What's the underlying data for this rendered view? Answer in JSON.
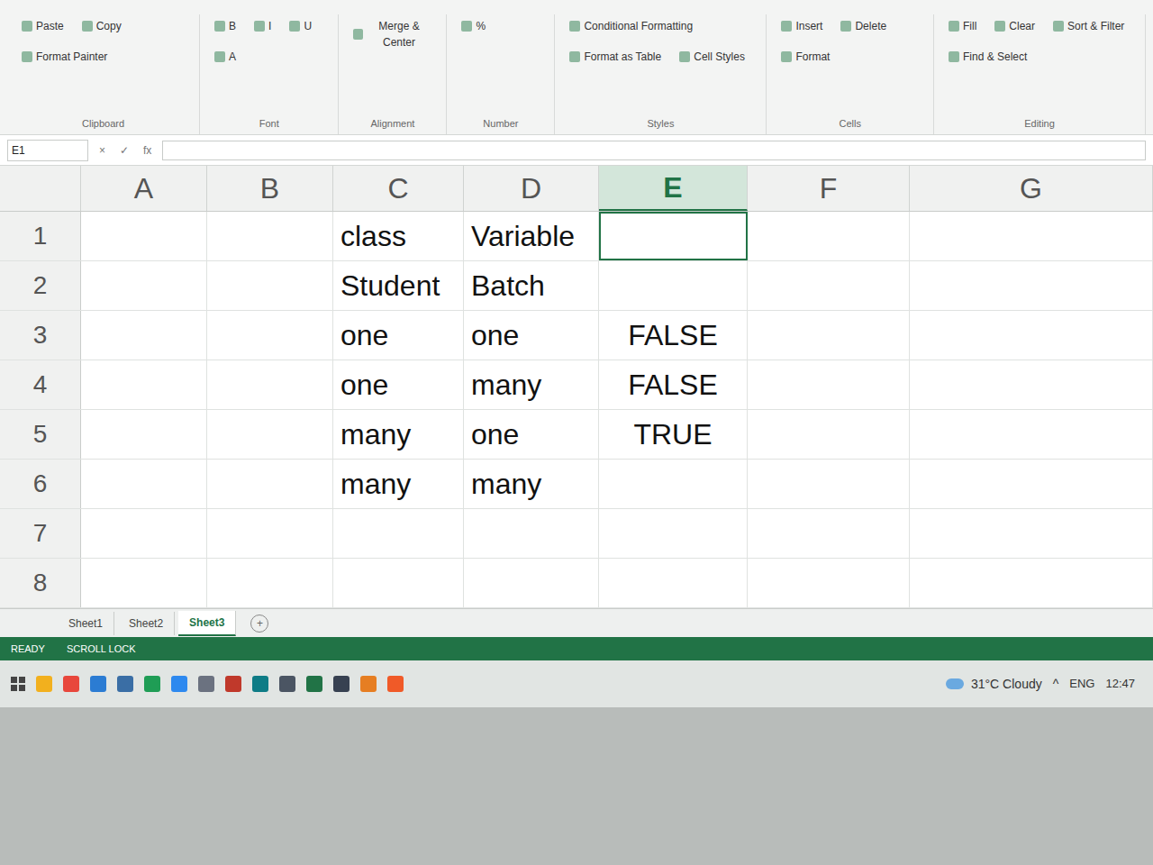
{
  "ribbon": {
    "groups": [
      {
        "label": "Clipboard",
        "items": [
          "Paste",
          "Copy",
          "Format Painter"
        ]
      },
      {
        "label": "Font",
        "items": [
          "B",
          "I",
          "U",
          "A"
        ]
      },
      {
        "label": "Alignment",
        "items": [
          "Merge & Center"
        ]
      },
      {
        "label": "Number",
        "items": [
          "%"
        ]
      },
      {
        "label": "Styles",
        "items": [
          "Conditional Formatting",
          "Format as Table",
          "Cell Styles"
        ]
      },
      {
        "label": "Cells",
        "items": [
          "Insert",
          "Delete",
          "Format"
        ]
      },
      {
        "label": "Editing",
        "items": [
          "Fill",
          "Clear",
          "Sort & Filter",
          "Find & Select"
        ]
      }
    ]
  },
  "name_box": "E1",
  "formula_buttons": [
    "×",
    "✓",
    "fx"
  ],
  "columns": [
    {
      "label": "A",
      "selected": false
    },
    {
      "label": "B",
      "selected": false
    },
    {
      "label": "C",
      "selected": false
    },
    {
      "label": "D",
      "selected": false
    },
    {
      "label": "E",
      "selected": true
    },
    {
      "label": "F",
      "selected": false
    },
    {
      "label": "G",
      "selected": false
    }
  ],
  "rows": [
    {
      "label": "1",
      "cells": [
        {
          "text": "",
          "kind": "text",
          "selected": false
        },
        {
          "text": "",
          "kind": "text",
          "selected": false
        },
        {
          "text": "class",
          "kind": "text",
          "selected": false
        },
        {
          "text": "Variable",
          "kind": "text",
          "selected": false
        },
        {
          "text": "",
          "kind": "text",
          "selected": true
        },
        {
          "text": "",
          "kind": "text",
          "selected": false
        },
        {
          "text": "",
          "kind": "text",
          "selected": false
        }
      ]
    },
    {
      "label": "2",
      "cells": [
        {
          "text": "",
          "kind": "text",
          "selected": false
        },
        {
          "text": "",
          "kind": "text",
          "selected": false
        },
        {
          "text": "Student",
          "kind": "text",
          "selected": false
        },
        {
          "text": "Batch",
          "kind": "text",
          "selected": false
        },
        {
          "text": "",
          "kind": "text",
          "selected": false
        },
        {
          "text": "",
          "kind": "text",
          "selected": false
        },
        {
          "text": "",
          "kind": "text",
          "selected": false
        }
      ]
    },
    {
      "label": "3",
      "cells": [
        {
          "text": "",
          "kind": "text",
          "selected": false
        },
        {
          "text": "",
          "kind": "text",
          "selected": false
        },
        {
          "text": "one",
          "kind": "text",
          "selected": false
        },
        {
          "text": "one",
          "kind": "text",
          "selected": false
        },
        {
          "text": "FALSE",
          "kind": "bool",
          "selected": false
        },
        {
          "text": "",
          "kind": "text",
          "selected": false
        },
        {
          "text": "",
          "kind": "text",
          "selected": false
        }
      ]
    },
    {
      "label": "4",
      "cells": [
        {
          "text": "",
          "kind": "text",
          "selected": false
        },
        {
          "text": "",
          "kind": "text",
          "selected": false
        },
        {
          "text": "one",
          "kind": "text",
          "selected": false
        },
        {
          "text": "many",
          "kind": "text",
          "selected": false
        },
        {
          "text": "FALSE",
          "kind": "bool",
          "selected": false
        },
        {
          "text": "",
          "kind": "text",
          "selected": false
        },
        {
          "text": "",
          "kind": "text",
          "selected": false
        }
      ]
    },
    {
      "label": "5",
      "cells": [
        {
          "text": "",
          "kind": "text",
          "selected": false
        },
        {
          "text": "",
          "kind": "text",
          "selected": false
        },
        {
          "text": "many",
          "kind": "text",
          "selected": false
        },
        {
          "text": "one",
          "kind": "text",
          "selected": false
        },
        {
          "text": "TRUE",
          "kind": "bool",
          "selected": false
        },
        {
          "text": "",
          "kind": "text",
          "selected": false
        },
        {
          "text": "",
          "kind": "text",
          "selected": false
        }
      ]
    },
    {
      "label": "6",
      "cells": [
        {
          "text": "",
          "kind": "text",
          "selected": false
        },
        {
          "text": "",
          "kind": "text",
          "selected": false
        },
        {
          "text": "many",
          "kind": "text",
          "selected": false
        },
        {
          "text": "many",
          "kind": "text",
          "selected": false
        },
        {
          "text": "",
          "kind": "text",
          "selected": false
        },
        {
          "text": "",
          "kind": "text",
          "selected": false
        },
        {
          "text": "",
          "kind": "text",
          "selected": false
        }
      ]
    },
    {
      "label": "7",
      "cells": [
        {
          "text": "",
          "kind": "text",
          "selected": false
        },
        {
          "text": "",
          "kind": "text",
          "selected": false
        },
        {
          "text": "",
          "kind": "text",
          "selected": false
        },
        {
          "text": "",
          "kind": "text",
          "selected": false
        },
        {
          "text": "",
          "kind": "text",
          "selected": false
        },
        {
          "text": "",
          "kind": "text",
          "selected": false
        },
        {
          "text": "",
          "kind": "text",
          "selected": false
        }
      ]
    },
    {
      "label": "8",
      "cells": [
        {
          "text": "",
          "kind": "text",
          "selected": false
        },
        {
          "text": "",
          "kind": "text",
          "selected": false
        },
        {
          "text": "",
          "kind": "text",
          "selected": false
        },
        {
          "text": "",
          "kind": "text",
          "selected": false
        },
        {
          "text": "",
          "kind": "text",
          "selected": false
        },
        {
          "text": "",
          "kind": "text",
          "selected": false
        },
        {
          "text": "",
          "kind": "text",
          "selected": false
        }
      ]
    }
  ],
  "sheet_tabs": [
    {
      "label": "Sheet1",
      "selected": false
    },
    {
      "label": "Sheet2",
      "selected": false
    },
    {
      "label": "Sheet3",
      "selected": true
    }
  ],
  "add_sheet": "+",
  "status_bar": [
    "READY",
    "SCROLL LOCK"
  ],
  "taskbar": {
    "apps": [
      {
        "color": "#f2b01e"
      },
      {
        "color": "#e8473c"
      },
      {
        "color": "#2b7cd3"
      },
      {
        "color": "#3a6ea5"
      },
      {
        "color": "#1f9d55"
      },
      {
        "color": "#2d89ef"
      },
      {
        "color": "#6b7280"
      },
      {
        "color": "#c0392b"
      },
      {
        "color": "#0e7c86"
      },
      {
        "color": "#4b5563"
      },
      {
        "color": "#217346"
      },
      {
        "color": "#374151"
      },
      {
        "color": "#e67e22"
      },
      {
        "color": "#f05a28"
      }
    ],
    "weather": "31°C Cloudy",
    "tray_arrow": "^",
    "language": "ENG",
    "time": "12:47"
  }
}
